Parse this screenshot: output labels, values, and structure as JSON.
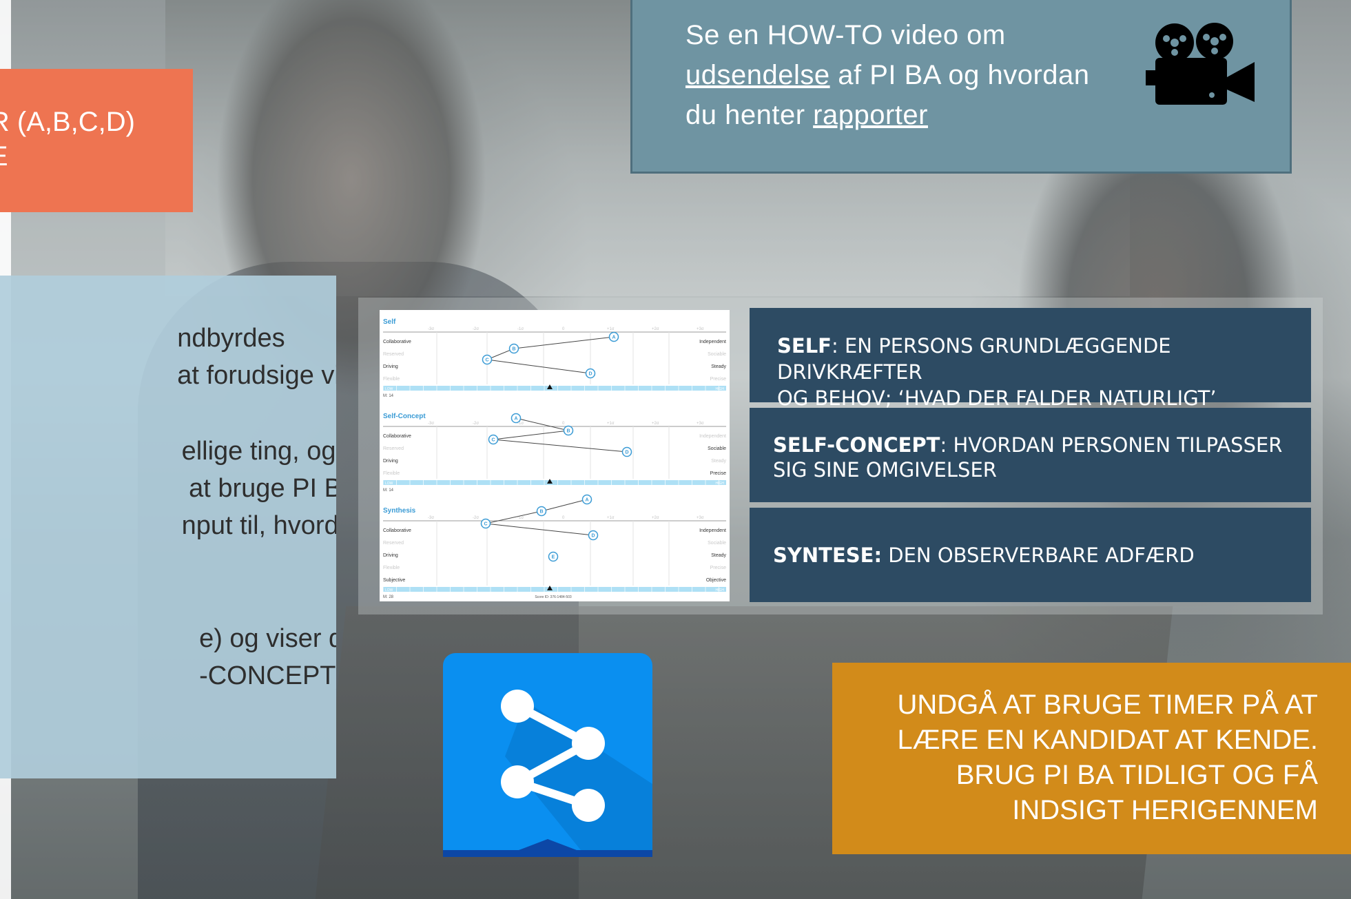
{
  "orange_box": {
    "lines": [
      "R (A,B,C,D)",
      "E"
    ]
  },
  "video_box": {
    "line1": "Se en HOW-TO video om",
    "link1": "udsendelse",
    "line2_rest": " af PI BA og hvordan",
    "line3_start": "du henter ",
    "link2": "rapporter",
    "icon": "movie-camera-icon"
  },
  "info_panel": {
    "para1": [
      "ndbyrdes",
      "at forudsige visse"
    ],
    "para2": [
      "ellige ting, og der",
      " at bruge PI BA",
      "nput til, hvordan"
    ],
    "para3": [
      "e) og viser den",
      "-CONCEPT) og"
    ]
  },
  "report": {
    "sections": [
      {
        "title": "Self",
        "left_traits": [
          "Collaborative",
          "Reserved",
          "Driving",
          "Flexible"
        ],
        "right_traits": [
          "Independent",
          "Sociable",
          "Steady",
          "Precise"
        ],
        "footer_left": "M: 14",
        "points": [
          "A",
          "B",
          "C",
          "D"
        ]
      },
      {
        "title": "Self-Concept",
        "left_traits": [
          "Collaborative",
          "Reserved",
          "Driving",
          "Flexible"
        ],
        "right_traits": [
          "Independent",
          "Sociable",
          "Steady",
          "Precise"
        ],
        "footer_left": "M: 14",
        "points": [
          "A",
          "B",
          "C",
          "D"
        ]
      },
      {
        "title": "Synthesis",
        "left_traits": [
          "Collaborative",
          "Reserved",
          "Driving",
          "Flexible",
          "Subjective"
        ],
        "right_traits": [
          "Independent",
          "Sociable",
          "Steady",
          "Precise",
          "Objective"
        ],
        "footer_left": "M: 28",
        "footer_center": "Score ID: 376-1484-503",
        "points": [
          "A",
          "B",
          "C",
          "D",
          "E"
        ]
      }
    ],
    "axis_ticks": [
      "-3σ",
      "-2σ",
      "-1σ",
      "0",
      "+1σ",
      "+2σ",
      "+3σ"
    ],
    "bar_left": "LOW",
    "bar_right": "HIGH"
  },
  "definitions": {
    "self_term": "SELF",
    "self_text_1": ": EN PERSONS GRUNDLÆGGENDE DRIVKRÆFTER",
    "self_text_2": "OG BEHOV; ‘HVAD DER FALDER NATURLIGT’",
    "concept_term": "SELF-CONCEPT",
    "concept_text_1": ": HVORDAN PERSONEN TILPASSER",
    "concept_text_2": "SIG SINE OMGIVELSER",
    "synthesis_term": "SYNTESE:",
    "synthesis_text": " DEN OBSERVERBARE ADFÆRD"
  },
  "share_tile": {
    "icon": "share-icon",
    "color": "#0a8ff0"
  },
  "gold_box": {
    "lines": [
      "UNDGÅ AT BRUGE TIMER PÅ AT",
      "LÆRE EN KANDIDAT AT KENDE.",
      "BRUG PI BA TIDLIGT OG FÅ",
      "INDSIGT HERIGENNEM"
    ]
  },
  "colors": {
    "orange": "#ee7451",
    "video_box": "#6f94a2",
    "info_panel": "#b0cddb",
    "definition_box": "#2d4b63",
    "gold": "#d28b1a",
    "chart_accent": "#3a9bd5"
  }
}
